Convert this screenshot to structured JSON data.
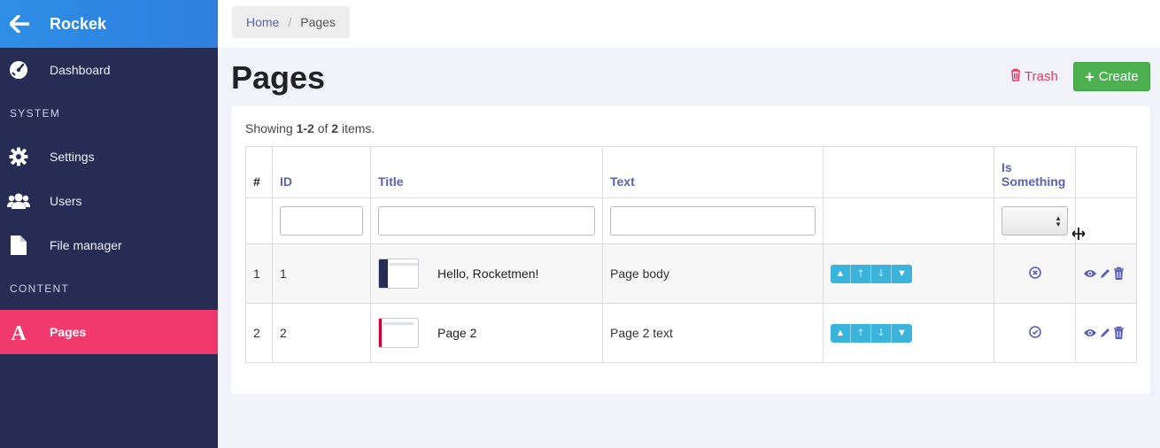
{
  "app": {
    "name": "Rockek"
  },
  "sidebar": {
    "items": [
      {
        "label": "Dashboard",
        "icon": "dashboard-icon"
      }
    ],
    "section_system": "SYSTEM",
    "system_items": [
      {
        "label": "Settings",
        "icon": "gear-icon"
      },
      {
        "label": "Users",
        "icon": "users-icon"
      },
      {
        "label": "File manager",
        "icon": "file-icon"
      }
    ],
    "section_content": "CONTENT",
    "content_items": [
      {
        "label": "Pages",
        "icon": "pages-icon",
        "active": true
      }
    ]
  },
  "breadcrumb": {
    "home": "Home",
    "separator": "/",
    "current": "Pages"
  },
  "header": {
    "title": "Pages",
    "trash_label": "Trash",
    "create_label": "Create"
  },
  "summary": {
    "prefix": "Showing ",
    "range": "1-2",
    "of": " of ",
    "total": "2",
    "suffix": " items."
  },
  "table": {
    "columns": {
      "hash": "#",
      "id": "ID",
      "title": "Title",
      "text": "Text",
      "actions": "",
      "is_something_1": "Is",
      "is_something_2": "Something"
    },
    "rows": [
      {
        "num": "1",
        "id": "1",
        "title": "Hello, Rocketmen!",
        "text": "Page body",
        "is_something": "no"
      },
      {
        "num": "2",
        "id": "2",
        "title": "Page 2",
        "text": "Page 2 text",
        "is_something": "yes"
      }
    ]
  },
  "colors": {
    "sidebar": "#272c54",
    "accent_active": "#f0396d",
    "link": "#5a5fb8",
    "create": "#4cb050",
    "trash": "#e8395e",
    "move_buttons": "#3bb4dc"
  }
}
